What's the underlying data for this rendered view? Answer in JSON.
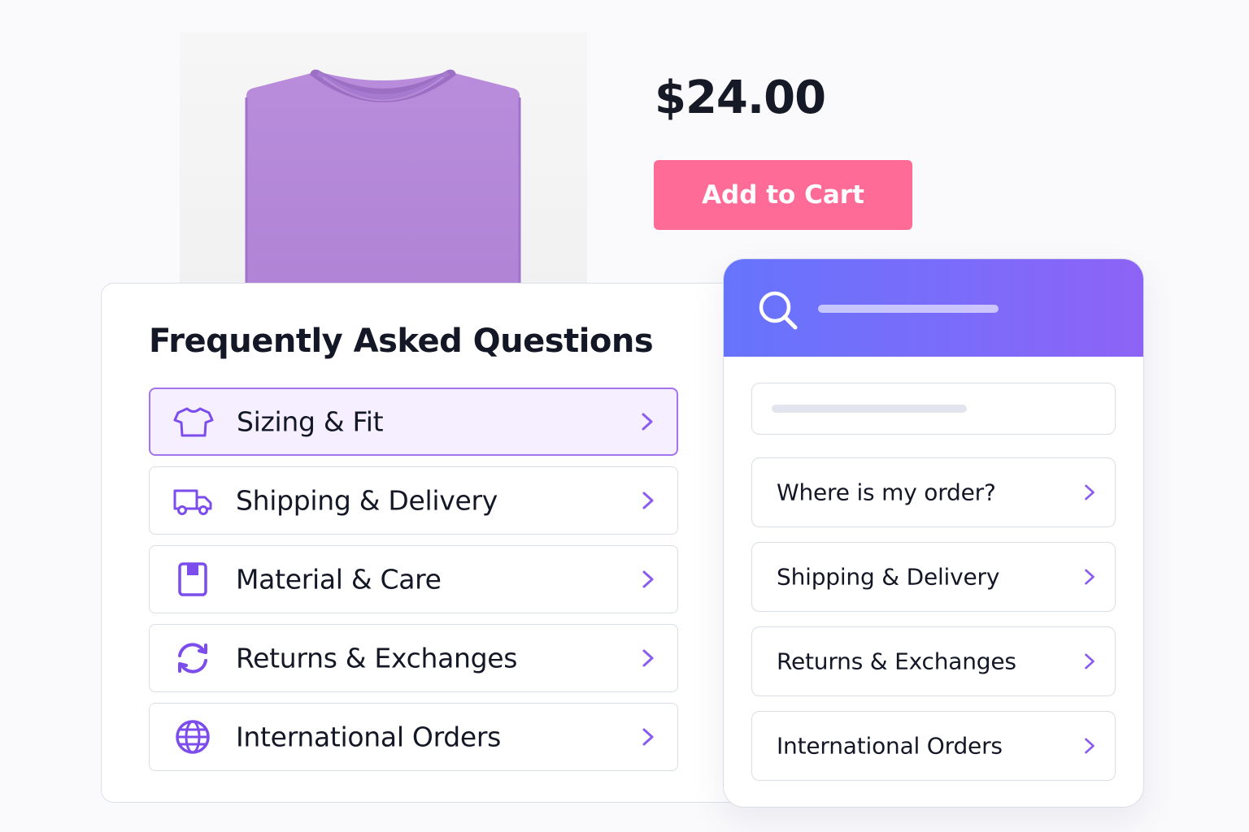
{
  "product": {
    "image_alt": "",
    "price": "$24.00",
    "add_to_cart_label": "Add to Cart",
    "shirt_color": "#b589d8"
  },
  "faq": {
    "title": "Frequently Asked Questions",
    "items": [
      {
        "label": "Sizing & Fit",
        "icon": "tshirt-icon",
        "active": true
      },
      {
        "label": "Shipping & Delivery",
        "icon": "truck-icon",
        "active": false
      },
      {
        "label": "Material & Care",
        "icon": "fabric-tag-icon",
        "active": false
      },
      {
        "label": "Returns & Exchanges",
        "icon": "refresh-icon",
        "active": false
      },
      {
        "label": "International Orders",
        "icon": "globe-icon",
        "active": false
      }
    ]
  },
  "help_widget": {
    "search_icon": "search-icon",
    "items": [
      {
        "label": "Where is my order?"
      },
      {
        "label": "Shipping & Delivery"
      },
      {
        "label": "Returns & Exchanges"
      },
      {
        "label": "International Orders"
      }
    ]
  },
  "colors": {
    "accent": "#7c4dec",
    "cart_button": "#ff6b97",
    "widget_gradient_start": "#6674fb",
    "widget_gradient_end": "#8d63f6",
    "active_item_bg": "#f6efff",
    "active_item_border": "#a474ee"
  }
}
